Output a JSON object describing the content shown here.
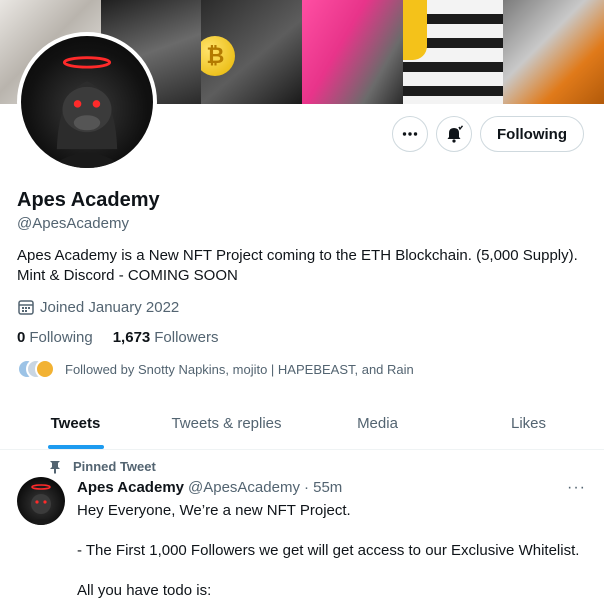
{
  "profile": {
    "name": "Apes Academy",
    "handle": "@ApesAcademy",
    "bio_line1": "Apes Academy is a New NFT Project coming to the ETH Blockchain. (5,000 Supply).",
    "bio_line2": "Mint & Discord - COMING SOON",
    "joined": "Joined January 2022",
    "following_count": "0",
    "following_label": "Following",
    "followers_count": "1,673",
    "followers_label": "Followers",
    "followed_by": "Followed by Snotty Napkins, mojito | HAPEBEAST, and Rain"
  },
  "actions": {
    "more_icon": "more-icon",
    "notify_icon": "bell-icon",
    "follow_label": "Following"
  },
  "tabs": [
    {
      "label": "Tweets",
      "active": true
    },
    {
      "label": "Tweets & replies",
      "active": false
    },
    {
      "label": "Media",
      "active": false
    },
    {
      "label": "Likes",
      "active": false
    }
  ],
  "tweet": {
    "pinned_label": "Pinned Tweet",
    "author": "Apes Academy",
    "handle": "@ApesAcademy",
    "time": "· 55m",
    "more": "···",
    "line1": "Hey Everyone, We’re a new NFT Project.",
    "line2": "- The First 1,000 Followers we get will get access to our Exclusive Whitelist.",
    "line3": "All you have todo is:"
  },
  "colors": {
    "accent": "#1d9bf0",
    "text": "#0f1419",
    "muted": "#536471",
    "halo": "#ff2a2a"
  }
}
